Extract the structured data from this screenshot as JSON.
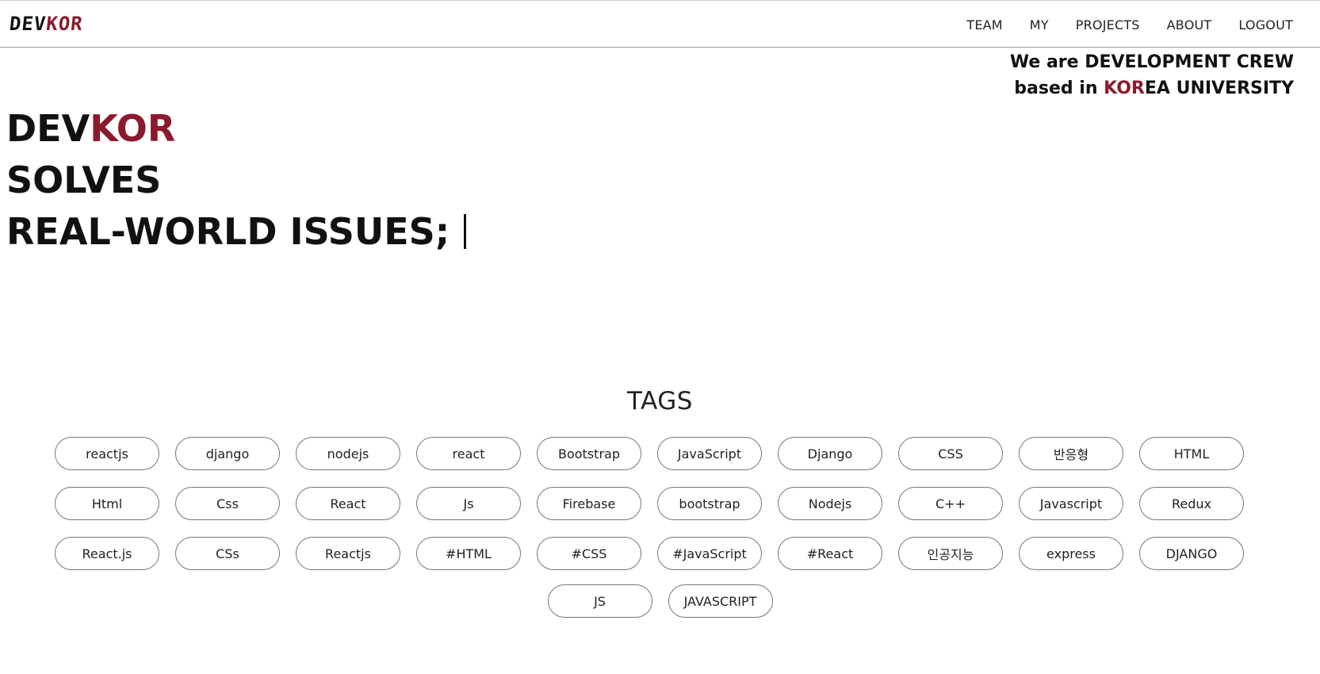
{
  "header": {
    "logo": {
      "dev": "DEV",
      "kor": "KOR"
    },
    "nav": [
      "TEAM",
      "MY",
      "PROJECTS",
      "ABOUT",
      "LOGOUT"
    ]
  },
  "tagline": {
    "line1": "We are DEVELOPMENT CREW",
    "line2_pre": "based in ",
    "line2_kor": "KOR",
    "line2_post": "EA UNIVERSITY"
  },
  "hero": {
    "dev": "DEV",
    "kor": "KOR",
    "line2": "SOLVES",
    "line3": "REAL-WORLD ISSUES;"
  },
  "tags": {
    "title": "TAGS",
    "items": [
      "reactjs",
      "django",
      "nodejs",
      "react",
      "Bootstrap",
      "JavaScript",
      "Django",
      "CSS",
      "반응형",
      "HTML",
      "Html",
      "Css",
      "React",
      "Js",
      "Firebase",
      "bootstrap",
      "Nodejs",
      "C++",
      "Javascript",
      "Redux",
      "React.js",
      "CSs",
      "Reactjs",
      "#HTML",
      "#CSS",
      "#JavaScript",
      "#React",
      "인공지능",
      "express",
      "DJANGO",
      "JS",
      "JAVASCRIPT"
    ]
  },
  "colors": {
    "accent": "#8b1a2e",
    "text": "#111111",
    "tag_border": "#777777"
  }
}
